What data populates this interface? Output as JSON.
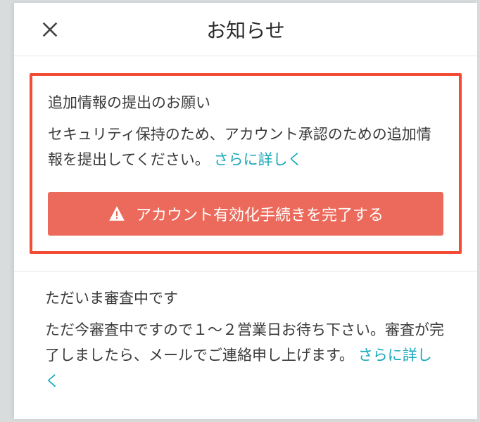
{
  "header": {
    "title": "お知らせ"
  },
  "notice": {
    "title": "追加情報の提出のお願い",
    "body": "セキュリティ保持のため、アカウント承認のための追加情報を提出してください。 ",
    "link_label": "さらに詳しく",
    "action_label": "アカウント有効化手続きを完了する"
  },
  "status": {
    "title": "ただいま審査中です",
    "body": "ただ今審査中ですので１〜２営業日お待ち下さい。審査が完了しましたら、メールでご連絡申し上げます。 ",
    "link_label": "さらに詳しく"
  }
}
